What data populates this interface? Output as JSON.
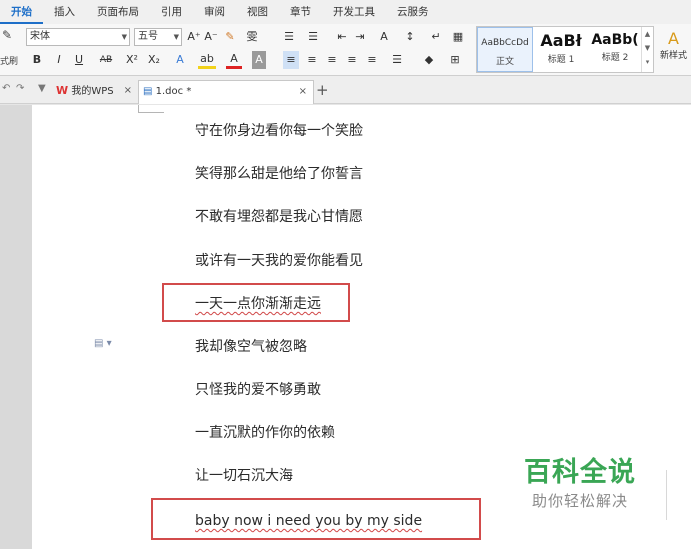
{
  "ribbon_tabs": [
    "开始",
    "插入",
    "页面布局",
    "引用",
    "审阅",
    "视图",
    "章节",
    "开发工具",
    "云服务"
  ],
  "ribbon": {
    "edge_label": "式刷",
    "font_name": "宋体",
    "font_size": "五号",
    "row1_buttons": [
      "A⁺",
      "A⁻",
      "✎",
      "雯",
      "☰",
      "☰",
      "⇤",
      "⇥",
      "A",
      "↕",
      "↵",
      "▦"
    ],
    "row2_buttons": [
      "B",
      "I",
      "U",
      "AB",
      "X²",
      "X₂",
      "A",
      "ab",
      "A",
      "A",
      "≡",
      "≡",
      "≡",
      "≡",
      "≡",
      "☰",
      "◆",
      "⊞"
    ],
    "styles": [
      {
        "sample": "AaBbCcDd",
        "name": "正文"
      },
      {
        "sample": "AaBł",
        "name": "标题 1"
      },
      {
        "sample": "AaBb(",
        "name": "标题 2"
      }
    ],
    "new_style_label": "新样式"
  },
  "doc_tabs": [
    {
      "logo": "W",
      "title": "我的WPS"
    },
    {
      "title": "1.doc *"
    }
  ],
  "document_lines": [
    "守在你身边看你每一个笑脸",
    "笑得那么甜是他给了你誓言",
    "不敢有埋怨都是我心甘情愿",
    "或许有一天我的爱你能看见",
    "一天一点你渐渐走远",
    "我却像空气被忽略",
    "只怪我的爱不够勇敢",
    "一直沉默的作你的依赖",
    "让一切石沉大海",
    "baby now i need you by my side"
  ],
  "watermark": {
    "title": "百科全说",
    "subtitle": "助你轻松解决"
  },
  "colors": {
    "accent": "#1e6fc8",
    "highlight_box": "#d24b4b",
    "watermark_green": "#3aa655"
  }
}
